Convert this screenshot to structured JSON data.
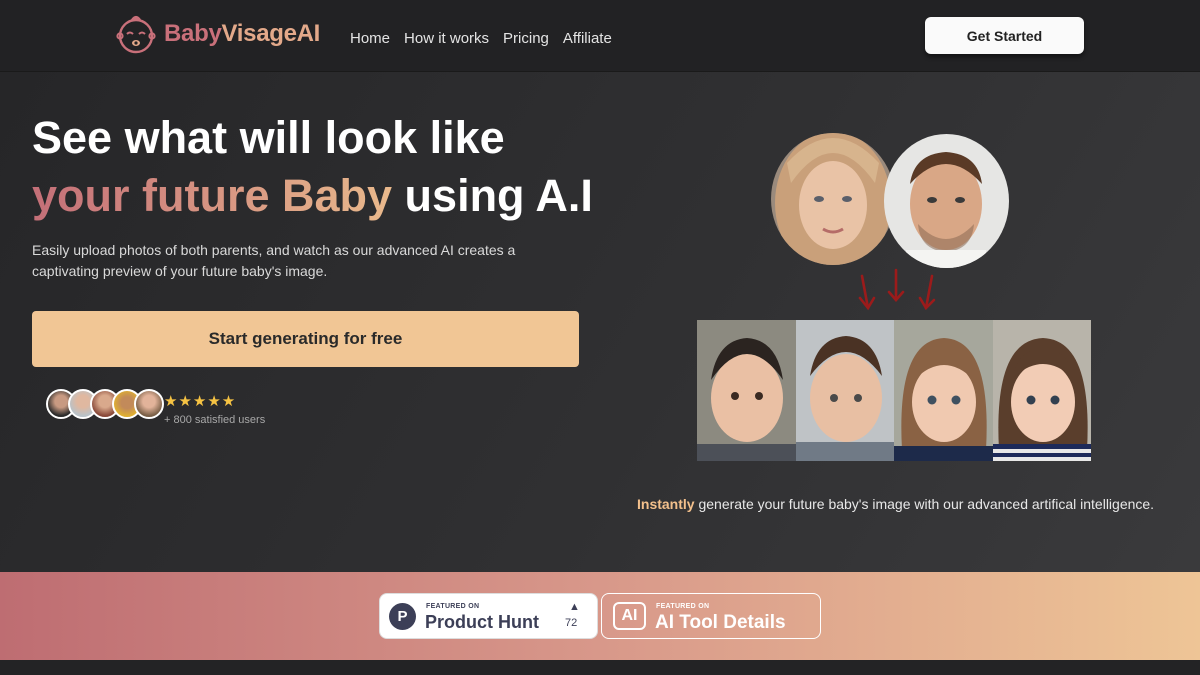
{
  "brand": {
    "name_part1": "Baby",
    "name_part2": "VisageAI",
    "accent": "#c9707a",
    "accent2": "#e3a98a"
  },
  "nav": {
    "links": [
      "Home",
      "How it works",
      "Pricing",
      "Affiliate"
    ],
    "cta": "Get Started"
  },
  "hero": {
    "headline_line1": "See what will look like",
    "headline_gradient": "your future Baby",
    "headline_rest": " using A.I",
    "subtitle": "Easily upload photos of both parents, and watch as our advanced AI creates a captivating preview of your future baby's image.",
    "cta": "Start generating for free",
    "cta_color": "#f1c695",
    "stars": "★★★★★",
    "users_text": "+ 800 satisfied users",
    "instantly_strong": "Instantly",
    "instantly_rest": " generate your future baby's image with our advanced artifical intelligence."
  },
  "badges": {
    "ph_small": "FEATURED ON",
    "ph_big": "Product Hunt",
    "ph_letter": "P",
    "ph_votes": "72",
    "ai_small": "FEATURED ON",
    "ai_big": "AI Tool Details",
    "ai_logo": "AI"
  }
}
